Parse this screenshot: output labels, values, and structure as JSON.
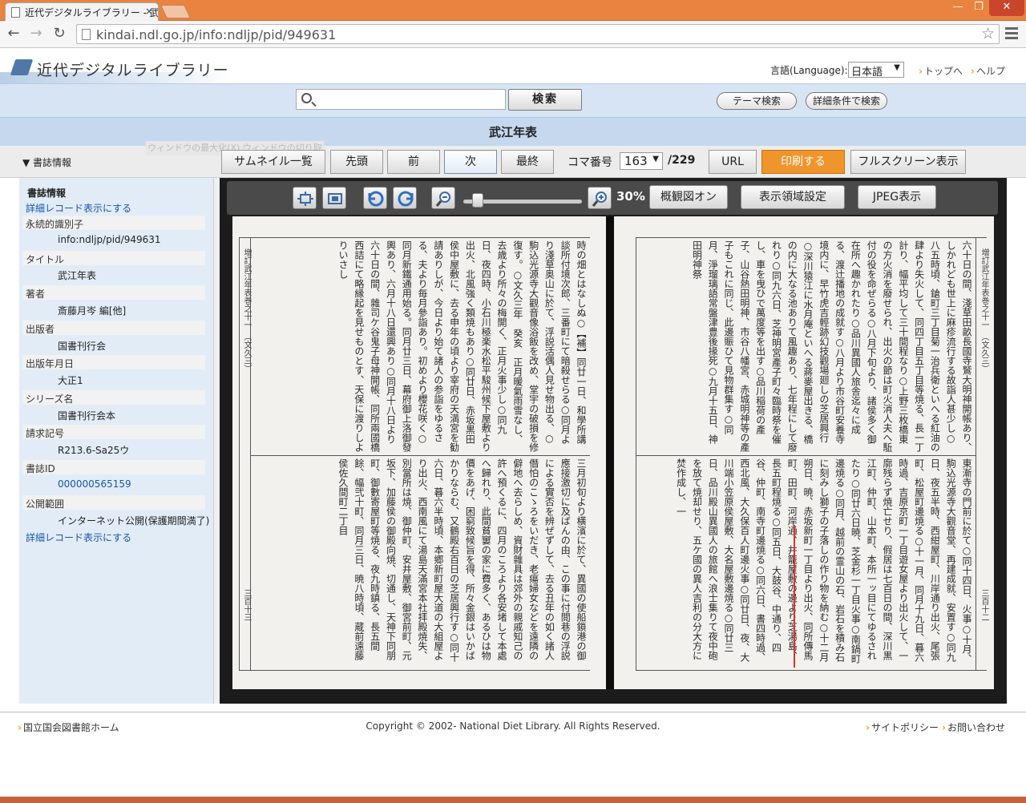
{
  "browser": {
    "tab_title": "近代デジタルライブラリー - 武",
    "tab_close": "×",
    "url": "kindai.ndl.go.jp/info:ndljp/pid/949631",
    "min": "—",
    "max": "❐",
    "close": "✕"
  },
  "header": {
    "site_name": "近代デジタルライブラリー",
    "language_label": "言語(Language):",
    "language_value": "日本語",
    "links": [
      "トップへ",
      "ヘルプ"
    ]
  },
  "search": {
    "placeholder": "",
    "button": "検索",
    "theme_search": "テーマ検索",
    "advanced": "詳細条件で検索"
  },
  "title": "武江年表",
  "ghost_text": "ウィンドウの最大化(X) ウィンドウの切り取り(W)",
  "controls": {
    "info_toggle": "▼ 書誌情報",
    "thumbnails": "サムネイル一覧",
    "first": "先頭",
    "prev": "前",
    "next": "次",
    "last": "最終",
    "frame_label": "コマ番号",
    "frame_value": "163",
    "frame_total": "/229",
    "url": "URL",
    "print": "印刷する",
    "fullscreen": "フルスクリーン表示"
  },
  "sidebar": {
    "heading": "書誌情報",
    "detail_link": "詳細レコード表示にする",
    "fields": [
      {
        "label": "永続的識別子",
        "value": "info:ndljp/pid/949631"
      },
      {
        "label": "タイトル",
        "value": "武江年表"
      },
      {
        "label": "著者",
        "value": "斎藤月岑 編[他]"
      },
      {
        "label": "出版者",
        "value": "国書刊行会"
      },
      {
        "label": "出版年月日",
        "value": "大正1"
      },
      {
        "label": "シリーズ名",
        "value": "国書刊行会本"
      },
      {
        "label": "請求記号",
        "value": "R213.6-Sa25ウ"
      },
      {
        "label": "書誌ID",
        "value": "000000565159"
      },
      {
        "label": "公開範囲",
        "value": "インターネット公開(保護期間満了)"
      }
    ],
    "detail_link_bottom": "詳細レコード表示にする"
  },
  "viewer": {
    "zoom": "30%",
    "overview": "概観図オン",
    "area_setting": "表示領域設定",
    "jpeg": "JPEG表示",
    "left_page": {
      "header": "増訂武江年表巻之十一　（文久三）",
      "page_no": "三百十三",
      "upper": "時の畑とはなしぬ○【補】同廿一日、和學所講談所付境次郎、三番町にて暗殺せらる○同月より淺草奥山に於て、浮説活偶人見せ物出る、○駒込光源寺大觀音像浴飯を改め、堂宇の破損を修復す。○文久三年　癸亥　正月暖氣雨雪なし、去歳より所々の梅開く、正月火事少し○同九日、夜四時、小石川極楽水松平駿州候下屋敷より出火、北風強く類焼もあり○同廿日、赤坂黒田侯中屋敷に、去る申年の頃より宰府の天満宮を勧請ありしが、今日より始て諸人の参詣をゆるさる、夫より毎月參詣あり。初めより櫻花咲く○同月新鐵通用始る。同月廿三日、幕府御上洛御發輿あり、六月十八日還興あり○同月十八日より六十日の間、雜司ケ谷鬼子母神開帳、同所兩國橋西詰にて略縁起を見せものとす、天保に渡りしよりいさし",
      "lower": "三月初旬より橫濱に於て、異國の使船鎖港の御應接激切に及ばんの由、この事に付閲巷の浮説による實否を辨ぜずして、去る丑年の如く諸人僭怕のこゝろをいだき、老瘍婦女などを遠隣の僻地へ去らしめ、資財雜具は郊外の親戚知己の許へ預くるに、四月のころより各安堵して本處へ歸れり、此間貧窶の家に費多く、あるひは物價をあげ、困窮致候旨を得、所々金銀はいかばかりならむ、又鶴殿右百日の芝居興行す○同十六日、暮六半時頃、本郷新町屋大道の大組屋より出火、西南風にて湯島天滿宮本社拝殿焼失、別當所は焼、御仲町、安井屋敷、御宮前町、元坂下、加藤侯の御殿向焼、切通し、天神下同朋町、御數寄屋町等焼る、夜九時鎮る、長五間餘、幅弐十町、同月三日、暁八時頃、蔵前遠藤侯佐久間町二丁目"
    },
    "right_page": {
      "header": "増訂武江年表巻之十一　（文久三）",
      "page_no": "三百十二",
      "upper": "六十日の間、淺草田畝長國寺鷲大明神開帳あり、しかれども世上に麻疹流行する故詣人甚少し○八五時頃、鎗町三丁目菊一治兵衛といへる紅油の肆より失火して、同四丁目五丁目等焼る、長一丁計り、幅平均して三十間程なり○上野三枚橋東の方火消を廢せられ、出火の節は町火消人夫へ駈付の役を命ぜらる○八月下旬より、諸侯多く御在所へ趣かれたり○品川異國人旅舎迄々に成る、渡辻播地の成就す○八月より市谷町安養寺境内に、早竹虎吉輕跡幻技觀場廻しの芝居興行○深川猿江に水月庵といへる蔣麥屋出きる、橋の内に大なる池ありて風趣あり、七年程にして廢れり○同九六日、芝神明宮產子町々臨時祭を催し、車を曳ひで萬度等を出す○品川稲荷の產子、山谷熱田明神、市谷八幡宮、赤城明神等の產子もこれに同じ、此邊賑ひて見物群集す○同月、淨瑠璃語常盤津豊後掾死○九月十五日、神田明神祭",
      "lower": "東漸寺の門前に於て○同十四日、火事○十月、駒込光源寺大觀音堂、再建成就、安置す○同九日、夜五半時、西紺屋町、川岸通り出火、尾張町、松屋町邊焼る○十一月、同月十九日、暮六時過、吉原京町一丁目遊女屋より出火して、一廓残らず焼亡せり、假居は七百日の間、深川黒江町、仲町、山本町、本所一ッ目にてゆるされたり○同廿六日暁、芝金杉一丁目火事○南鍋町邊焼る○同月、越前の霊山の石、岩石を積み石に刻みし獅子の子落しの作り物を納む○十二月朔日、暁、赤坂新町一丁目より出火、同所傳馬町、田町、河岸通、井籠屋敷の邊より芝湯島、長五町程焼る○同五日、大鼓谷、中通り、四谷、仲町、南寺町邊焼る○同六日、書四時過、西北風、大久保百人町邊火事○同廿日、夜、大川端小笠原侯屋敷、大名屋敷邊焼る○同廿三日、品川殿山異國人の旅館へ浪士集りて夜中砲を放て焼却せり、五ケ國の異人吉利の分大方に焚作成し、一"
    }
  },
  "footer": {
    "left": "国立国会図書館ホーム",
    "copyright": "Copyright © 2002- National Diet Library. All Rights Reserved.",
    "right": [
      "サイトポリシー",
      "お問い合わせ"
    ]
  }
}
